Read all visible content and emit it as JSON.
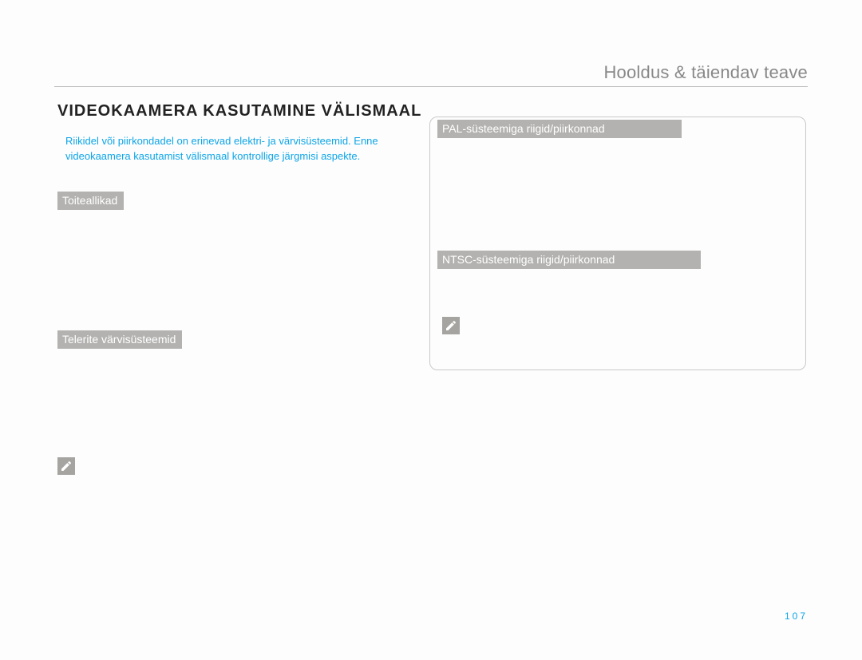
{
  "header": {
    "title": "Hooldus & täiendav teave"
  },
  "section": {
    "title": "VIDEOKAAMERA KASUTAMINE VÄLISMAAL"
  },
  "intro": {
    "text": "Riikidel või piirkondadel on erinevad elektri- ja värvisüsteemid. Enne videokaamera kasutamist välismaal kontrollige järgmisi aspekte."
  },
  "labels": {
    "toiteallikad": "Toiteallikad",
    "telerite": "Telerite värvisüsteemid",
    "pal": "PAL-süsteemiga riigid/piirkonnad",
    "ntsc": "NTSC-süsteemiga riigid/piirkonnad"
  },
  "icons": {
    "note_left": "note-icon",
    "note_right": "note-icon"
  },
  "page_number": "107"
}
